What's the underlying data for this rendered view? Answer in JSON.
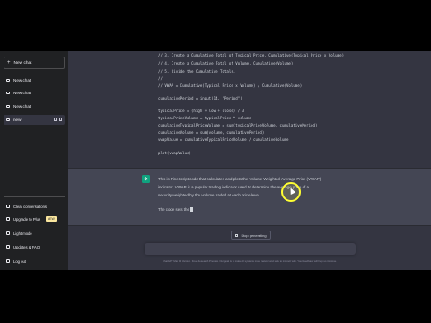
{
  "sidebar": {
    "new_chat": "New chat",
    "items": [
      {
        "label": "New chat"
      },
      {
        "label": "New chat"
      },
      {
        "label": "New chat"
      },
      {
        "label": "new"
      }
    ],
    "bottom": [
      {
        "label": "Clear conversations",
        "icon": "trash-icon"
      },
      {
        "label": "Upgrade to Plus",
        "icon": "user-icon",
        "badge": "NEW"
      },
      {
        "label": "Light mode",
        "icon": "sun-icon"
      },
      {
        "label": "Updates & FAQ",
        "icon": "external-link-icon"
      },
      {
        "label": "Log out",
        "icon": "logout-icon"
      }
    ]
  },
  "code": [
    "// 3. Create a Cumulative Total of Typical Price. Cumulative(Typical Price x Volume)",
    "// 4. Create a Cumulative Total of Volume. Cumulative(Volume)",
    "// 5. Divide the Cumulative Totals.",
    "//",
    "// VWAP = Cumulative(Typical Price x Volume) / Cumulative(Volume)",
    "",
    "cumulativePeriod = input(14, \"Period\")",
    "",
    "typicalPrice = (high + low + close) / 3",
    "typicalPriceVolume = typicalPrice * volume",
    "cumulativeTypicalPriceVolume = sum(typicalPriceVolume, cumulativePeriod)",
    "cumulativeVolume = sum(volume, cumulativePeriod)",
    "vwapValue = cumulativeTypicalPriceVolume / cumulativeVolume",
    "",
    "plot(vwapValue)"
  ],
  "answer": {
    "avatar_icon": "openai-logo-icon",
    "lines": [
      "This is PineScript code that calculates and plots the Volume Weighted Average Price (VWAP)",
      "indicator. VWAP is a popular trading indicator used to determine the average price of a",
      "security weighted by the volume traded at each price level."
    ],
    "typing": "The code sets the"
  },
  "stop_button": "Stop generating",
  "footer": "ChatGPT Mar 14 Version. Free Research Preview. Our goal is to make AI systems more natural and safe to interact with. Your feedback will help us improve."
}
